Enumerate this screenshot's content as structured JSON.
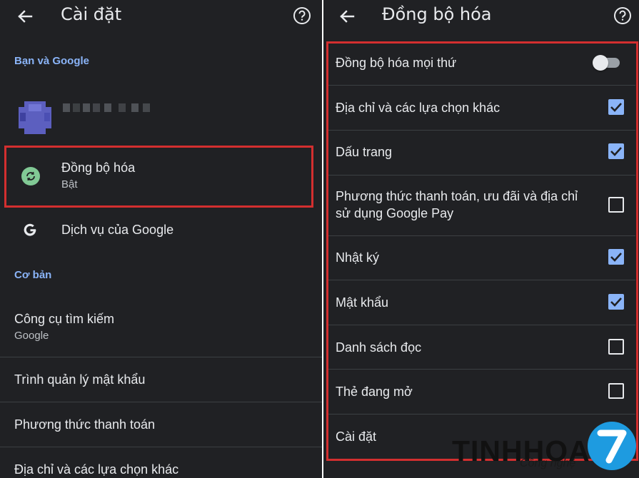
{
  "left": {
    "title": "Cài đặt",
    "section_account": "Bạn và Google",
    "sync": {
      "label": "Đồng bộ hóa",
      "status": "Bật"
    },
    "google_services": "Dịch vụ của Google",
    "section_basic": "Cơ bản",
    "search_engine": {
      "label": "Công cụ tìm kiếm",
      "value": "Google"
    },
    "password_manager": "Trình quản lý mật khẩu",
    "payment_methods": "Phương thức thanh toán",
    "addresses": "Địa chỉ và các lựa chọn khác"
  },
  "right": {
    "title": "Đồng bộ hóa",
    "sync_everything": {
      "label": "Đồng bộ hóa mọi thứ",
      "enabled": false
    },
    "items": [
      {
        "label": "Địa chỉ và các lựa chọn khác",
        "checked": true
      },
      {
        "label": "Dấu trang",
        "checked": true
      },
      {
        "label": "Phương thức thanh toán, ưu đãi và địa chỉ",
        "label2": "sử dụng Google Pay",
        "checked": false
      },
      {
        "label": "Nhật ký",
        "checked": true
      },
      {
        "label": "Mật khẩu",
        "checked": true
      },
      {
        "label": "Danh sách đọc",
        "checked": false
      },
      {
        "label": "Thẻ đang mở",
        "checked": false
      },
      {
        "label": "Cài đặt",
        "checked": false
      }
    ]
  },
  "watermark": {
    "brand": "TINHHOA",
    "tagline": "Công nghệ",
    "badge": "7"
  },
  "colors": {
    "background": "#202124",
    "accent": "#8ab4f8",
    "highlight": "#d32f2f",
    "sync_icon": "#81c995"
  }
}
